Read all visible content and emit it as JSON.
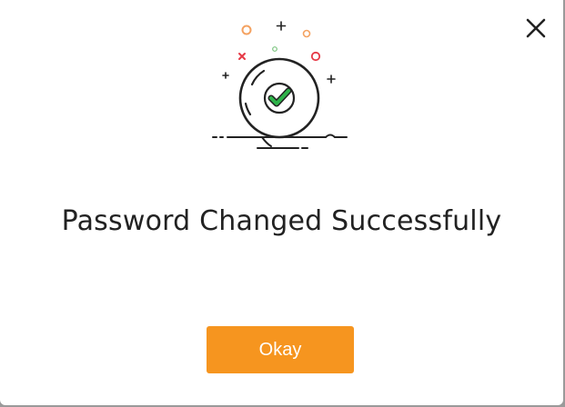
{
  "dialog": {
    "title": "Password Changed Successfully",
    "okay_label": "Okay",
    "close_icon": "close-icon",
    "illustration_icon": "success-checkmark-icon"
  },
  "colors": {
    "accent": "#f6951f",
    "check_green": "#2eb34a",
    "confetti_orange": "#f4a261",
    "confetti_red": "#e63946",
    "confetti_green": "#7bc47f",
    "outline": "#222222"
  }
}
